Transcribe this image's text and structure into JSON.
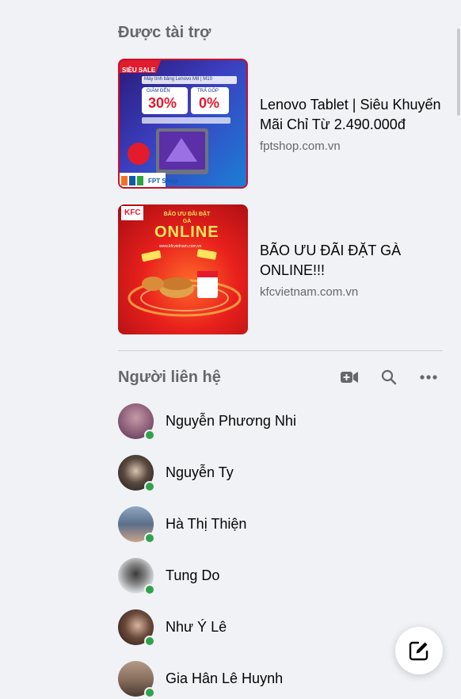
{
  "sponsored": {
    "title": "Được tài trợ",
    "ads": [
      {
        "title": "Lenovo Tablet | Siêu Khuyến Mãi Chỉ Từ 2.490.000đ",
        "domain": "fptshop.com.vn",
        "image_text": {
          "badge": "SIÊU SALE",
          "headline": "Máy tính bảng Lenovo M8 | M10",
          "discount_label": "GIẢM ĐẾN",
          "discount_value": "30%",
          "installment_label": "TRẢ GÓP",
          "installment_value": "0%",
          "brand": "FPT Shop"
        }
      },
      {
        "title": "BÃO ƯU ĐÃI ĐẶT GÀ ONLINE!!!",
        "domain": "kfcvietnam.com.vn",
        "image_text": {
          "logo": "KFC",
          "headline_small": "BÃO ƯU ĐÃI ĐẶT GÀ",
          "headline_big": "ONLINE",
          "url": "www.kfcvietnam.com.vn"
        }
      }
    ]
  },
  "contacts": {
    "title": "Người liên hệ",
    "header_icons": [
      "video-call-icon",
      "search-icon",
      "more-icon"
    ],
    "items": [
      {
        "name": "Nguyễn Phương Nhi",
        "online": true,
        "avatar_color": "#7a4e6b"
      },
      {
        "name": "Nguyễn Ty",
        "online": true,
        "avatar_color": "#2c2c2c"
      },
      {
        "name": "Hà Thị Thiện",
        "online": true,
        "avatar_color": "#5b6f8a"
      },
      {
        "name": "Tung Do",
        "online": true,
        "avatar_color": "#cfd3d8"
      },
      {
        "name": "Như Ý Lê",
        "online": true,
        "avatar_color": "#3a2a24"
      },
      {
        "name": "Gia Hân Lê Huynh",
        "online": true,
        "avatar_color": "#8a7060"
      }
    ]
  },
  "new_message_icon": "compose-icon",
  "colors": {
    "background": "#f0f2f5",
    "online": "#31a24c",
    "secondary_text": "#65676b"
  }
}
